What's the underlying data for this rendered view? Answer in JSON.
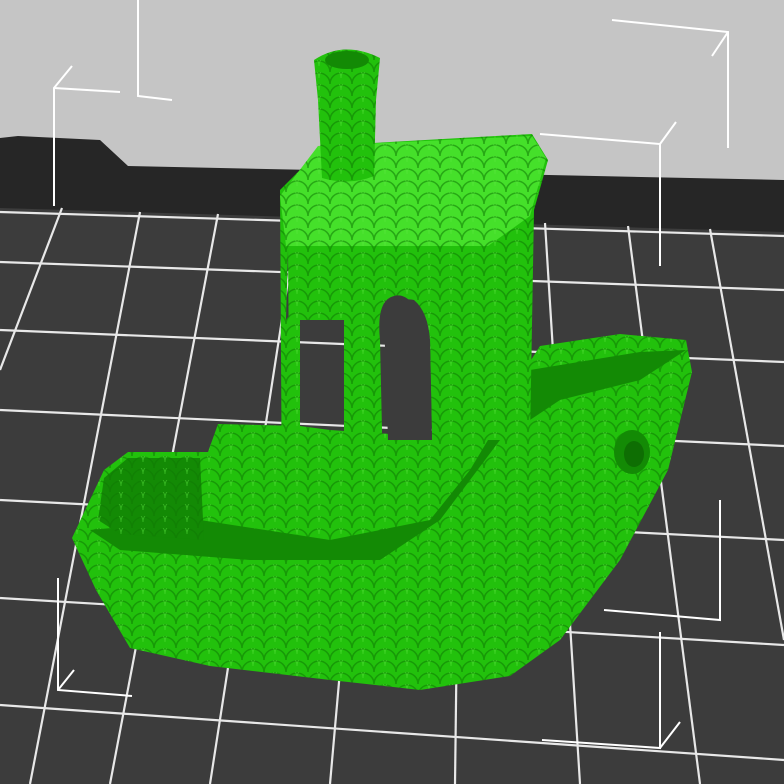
{
  "viewport": {
    "background_color": "#c5c5c5",
    "bed_color": "#3c3c3c",
    "bed_edge_color": "#262626",
    "grid_line_color": "#e8e8e8",
    "bounding_box_color": "#ffffff"
  },
  "model": {
    "color": "#22c10c",
    "shadow_color": "#138a05",
    "highlight_color": "#45e02a"
  }
}
